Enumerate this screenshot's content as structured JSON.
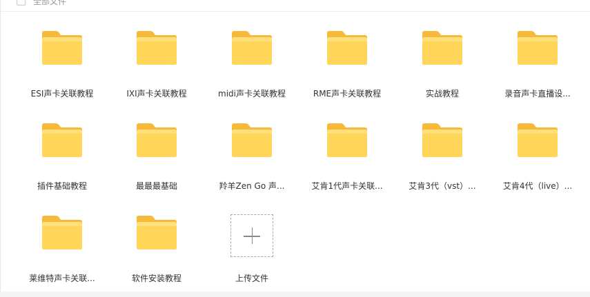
{
  "header": {
    "select_all_label": "全部文件"
  },
  "folders": [
    {
      "name": "ESI声卡关联教程"
    },
    {
      "name": "IXI声卡关联教程"
    },
    {
      "name": "midi声卡关联教程"
    },
    {
      "name": "RME声卡关联教程"
    },
    {
      "name": "实战教程"
    },
    {
      "name": "录音声卡直播设..."
    },
    {
      "name": "插件基础教程"
    },
    {
      "name": "最最最基础"
    },
    {
      "name": "羚羊Zen Go 声..."
    },
    {
      "name": "艾肯1代声卡关联..."
    },
    {
      "name": "艾肯3代（vst）..."
    },
    {
      "name": "艾肯4代（live）..."
    },
    {
      "name": "莱维特声卡关联..."
    },
    {
      "name": "软件安装教程"
    }
  ],
  "upload": {
    "label": "上传文件"
  },
  "colors": {
    "folder_back": "#F7B93A",
    "folder_front": "#FFD65A",
    "folder_front_light": "#FFE07A"
  }
}
